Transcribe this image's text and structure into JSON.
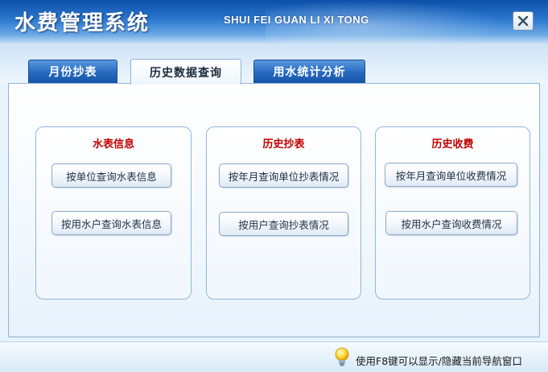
{
  "header": {
    "title": "水费管理系统",
    "subtitle": "SHUI FEI GUAN LI XI TONG",
    "close_icon": "close-icon"
  },
  "tabs": [
    {
      "label": "月份抄表",
      "active": false
    },
    {
      "label": "历史数据查询",
      "active": true
    },
    {
      "label": "用水统计分析",
      "active": false
    }
  ],
  "groups": [
    {
      "title": "水表信息",
      "buttons": [
        "按单位查询水表信息",
        "按用水户查询水表信息"
      ]
    },
    {
      "title": "历史抄表",
      "buttons": [
        "按年月查询单位抄表情况",
        "按用户查询抄表情况"
      ]
    },
    {
      "title": "历史收费",
      "buttons": [
        "按年月查询单位收费情况",
        "按用水户查询收费情况"
      ]
    }
  ],
  "footer": {
    "hint": "使用F8键可以显示/隐藏当前导航窗口",
    "icon": "lightbulb-icon"
  },
  "colors": {
    "header_dark": "#0b4fa8",
    "tab_blue": "#2a6cc2",
    "group_title_red": "#c00000",
    "border_blue": "#8fb7df"
  }
}
